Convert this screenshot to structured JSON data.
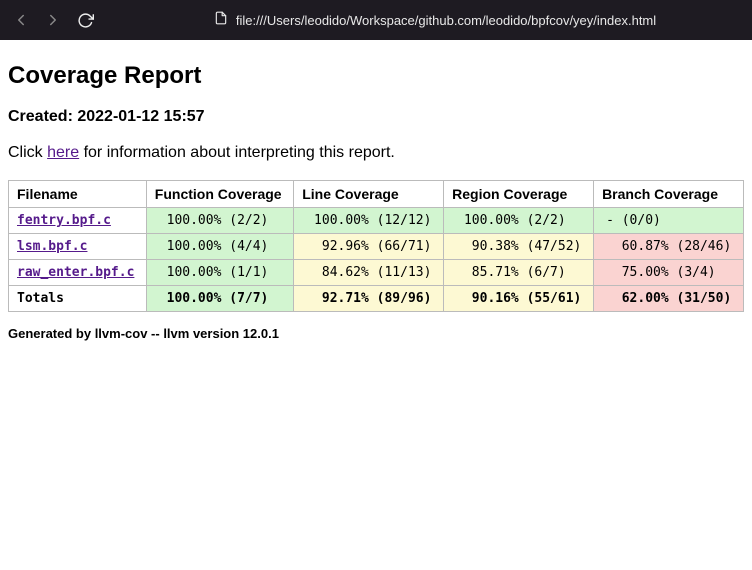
{
  "browser": {
    "url": "file:///Users/leodido/Workspace/github.com/leodido/bpfcov/yey/index.html"
  },
  "report": {
    "title": "Coverage Report",
    "created_label": "Created: 2022-01-12 15:57",
    "info_prefix": "Click ",
    "info_link": "here",
    "info_suffix": " for information about interpreting this report.",
    "columns": [
      "Filename",
      "Function Coverage",
      "Line Coverage",
      "Region Coverage",
      "Branch Coverage"
    ],
    "rows": [
      {
        "filename": "fentry.bpf.c",
        "func": {
          "text": " 100.00% (2/2)",
          "class": "bg-green"
        },
        "line": {
          "text": " 100.00% (12/12)",
          "class": "bg-green"
        },
        "region": {
          "text": " 100.00% (2/2)",
          "class": "bg-green"
        },
        "branch": {
          "text": "- (0/0)",
          "class": "bg-green"
        }
      },
      {
        "filename": "lsm.bpf.c",
        "func": {
          "text": " 100.00% (4/4)",
          "class": "bg-green"
        },
        "line": {
          "text": "  92.96% (66/71)",
          "class": "bg-yellow"
        },
        "region": {
          "text": "  90.38% (47/52)",
          "class": "bg-yellow"
        },
        "branch": {
          "text": "  60.87% (28/46)",
          "class": "bg-red"
        }
      },
      {
        "filename": "raw_enter.bpf.c",
        "func": {
          "text": " 100.00% (1/1)",
          "class": "bg-green"
        },
        "line": {
          "text": "  84.62% (11/13)",
          "class": "bg-yellow"
        },
        "region": {
          "text": "  85.71% (6/7)",
          "class": "bg-yellow"
        },
        "branch": {
          "text": "  75.00% (3/4)",
          "class": "bg-red"
        }
      }
    ],
    "totals": {
      "label": "Totals",
      "func": {
        "text": " 100.00% (7/7)",
        "class": "bg-green"
      },
      "line": {
        "text": "  92.71% (89/96)",
        "class": "bg-yellow"
      },
      "region": {
        "text": "  90.16% (55/61)",
        "class": "bg-yellow"
      },
      "branch": {
        "text": "  62.00% (31/50)",
        "class": "bg-red"
      }
    },
    "footer": "Generated by llvm-cov -- llvm version 12.0.1"
  }
}
